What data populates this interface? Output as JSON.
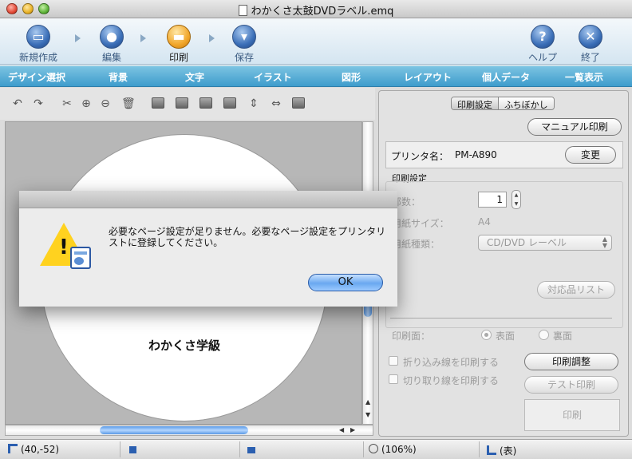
{
  "window": {
    "title": "わかくさ太鼓DVDラベル.emq"
  },
  "toolbar": {
    "new": "新規作成",
    "edit": "編集",
    "print": "印刷",
    "save": "保存",
    "help": "ヘルプ",
    "quit": "終了"
  },
  "tabs": [
    "デザイン選択",
    "背景",
    "文字",
    "イラスト",
    "図形",
    "レイアウト",
    "個人データ",
    "一覧表示"
  ],
  "canvas": {
    "disc_text": "わかくさ学級"
  },
  "panel": {
    "segments": [
      "印刷設定",
      "ふちぼかし"
    ],
    "manual_print": "マニュアル印刷",
    "printer_label": "プリンタ名：",
    "printer_name": "PM-A890",
    "change": "変更",
    "section_title": "印刷設定",
    "copies_label": "部数：",
    "copies_value": "1",
    "paper_size_label": "用紙サイズ：",
    "paper_size_value": "A4",
    "paper_type_label": "用紙種類：",
    "paper_type_value": "CD/DVD レーベル",
    "supported_list": "対応品リスト",
    "print_side_label": "印刷面：",
    "front": "表面",
    "back": "裏面",
    "fold_line": "折り込み線を印刷する",
    "cut_line": "切り取り線を印刷する",
    "adjust": "印刷調整",
    "test_print": "テスト印刷",
    "print": "印刷"
  },
  "dialog": {
    "message": "必要なページ設定が足りません。必要なページ設定をプリンタリストに登録してください。",
    "ok": "OK"
  },
  "status": {
    "coords": "(40,-52)",
    "zoom": "(106%)",
    "side": "(表)"
  },
  "colors": {
    "accent": "#3e9ccc",
    "print_orange": "#f1a72c",
    "ok_blue": "#6aa8f0"
  }
}
